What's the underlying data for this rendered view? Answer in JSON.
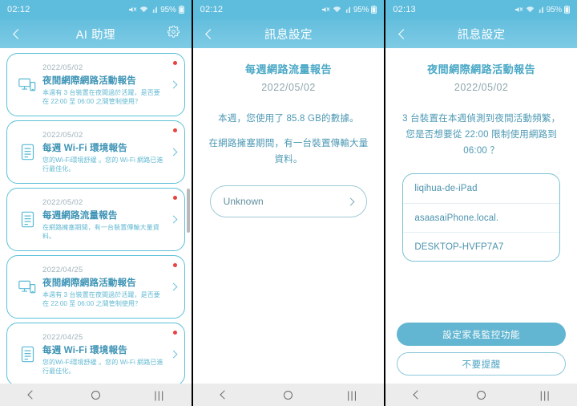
{
  "screens": [
    {
      "statusbar": {
        "time": "02:12",
        "battery": "95%",
        "icons": [
          "mute-icon",
          "wifi-icon",
          "signal-icon",
          "battery-icon"
        ]
      },
      "appbar": {
        "title": "AI 助理",
        "back_icon": "chevron-left-icon",
        "action_icon": "gear-icon"
      },
      "cards": [
        {
          "date": "2022/05/02",
          "title": "夜間網際網路活動報告",
          "desc": "本週有 3 台裝置在夜間過於活躍，是否要在 22:00 至 06:00 之間管制使用？",
          "icon": "devices-monitor-phone-icon",
          "unread": true
        },
        {
          "date": "2022/05/02",
          "title": "每週 Wi-Fi 環境報告",
          "desc": "您的Wi-Fi環境舒緩 。您的 Wi-Fi 網路已進行最佳化。",
          "icon": "document-report-icon",
          "unread": true
        },
        {
          "date": "2022/05/02",
          "title": "每週網路流量報告",
          "desc": "在網路擁塞期間，有一台裝置傳輸大量資料。",
          "icon": "document-report-icon",
          "unread": true
        },
        {
          "date": "2022/04/25",
          "title": "夜間網際網路活動報告",
          "desc": "本週有 3 台裝置在夜間過於活躍，是否要在 22:00 至 06:00 之間管制使用？",
          "icon": "devices-monitor-phone-icon",
          "unread": true
        },
        {
          "date": "2022/04/25",
          "title": "每週 Wi-Fi 環境報告",
          "desc": "您的Wi-Fi環境舒緩 。您的 Wi-Fi 網路已進行最佳化。",
          "icon": "document-report-icon",
          "unread": true
        }
      ]
    },
    {
      "statusbar": {
        "time": "02:12",
        "battery": "95%"
      },
      "appbar": {
        "title": "訊息設定",
        "back_icon": "chevron-left-icon"
      },
      "detail": {
        "title": "每週網路流量報告",
        "date": "2022/05/02",
        "paragraphs": [
          "本週，您使用了 85.8 GB的數據。",
          "在網路擁塞期間，有一台裝置傳輸大量資料。"
        ],
        "row_label": "Unknown"
      }
    },
    {
      "statusbar": {
        "time": "02:13",
        "battery": "95%"
      },
      "appbar": {
        "title": "訊息設定",
        "back_icon": "chevron-left-icon"
      },
      "detail": {
        "title": "夜間網際網路活動報告",
        "date": "2022/05/02",
        "paragraphs": [
          "3 台裝置在本週偵測到夜間活動頻繁，您是否想要從 22:00 限制使用網路到 06:00 ？"
        ],
        "devices": [
          "liqihua-de-iPad",
          "asaasaiPhone.local.",
          "DESKTOP-HVFP7A7"
        ],
        "primary_button": "設定家長監控功能",
        "secondary_button": "不要提醒"
      }
    }
  ],
  "navbar": {
    "back_icon": "nav-back-icon",
    "home_icon": "nav-home-icon",
    "recents_icon": "nav-recents-icon",
    "recents_glyph": "|||"
  },
  "colors": {
    "brand": "#5ebcdc",
    "accent_text": "#4aa8c6",
    "unread_dot": "#e8423f",
    "card_border": "#5cc0d8"
  }
}
